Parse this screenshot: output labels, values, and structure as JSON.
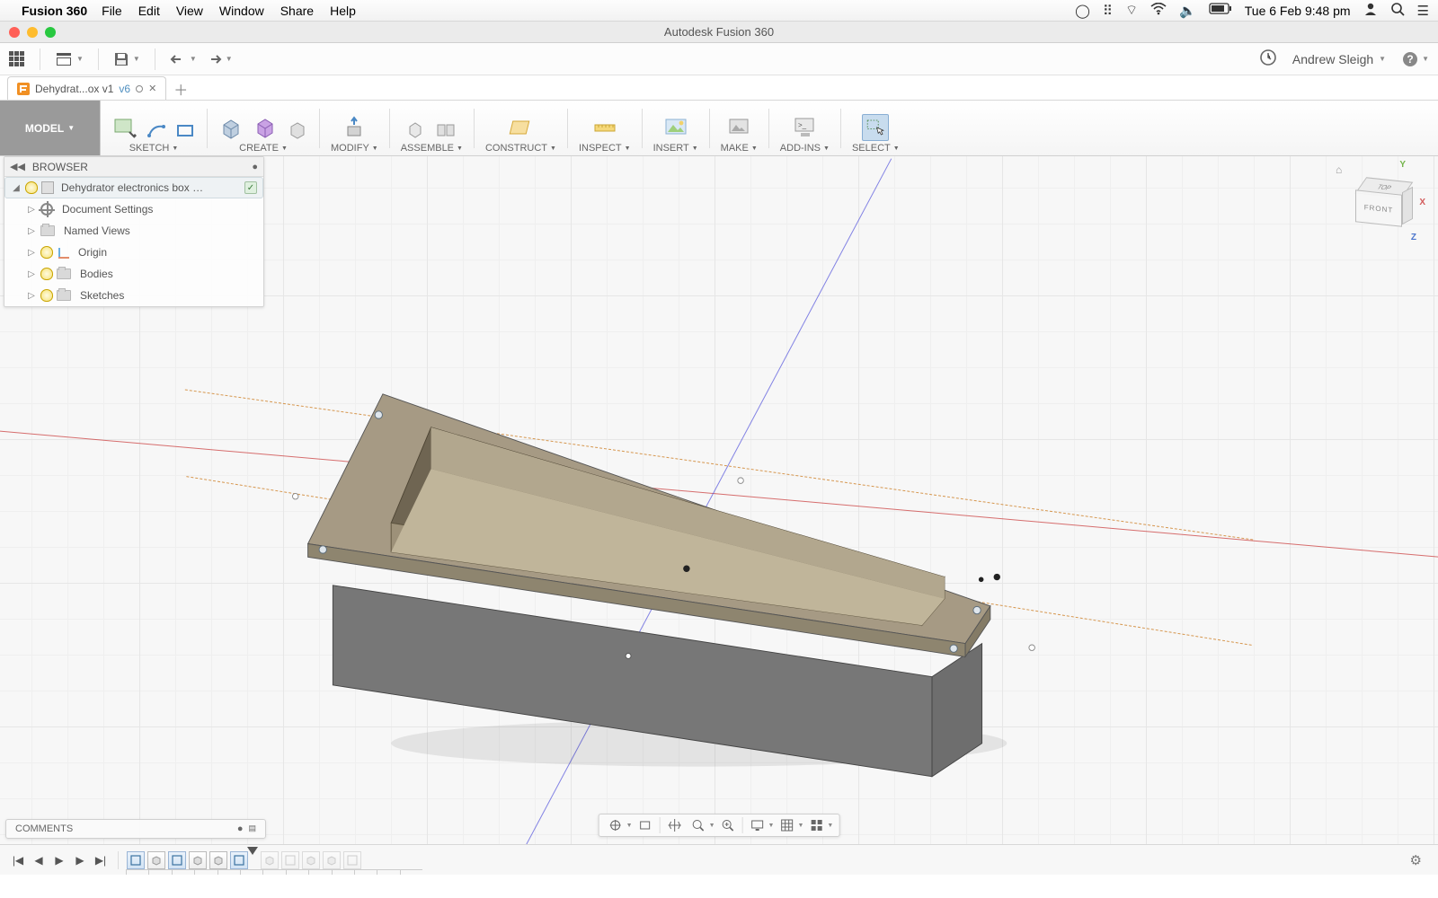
{
  "mac_menu": {
    "app": "Fusion 360",
    "items": [
      "File",
      "Edit",
      "View",
      "Window",
      "Share",
      "Help"
    ],
    "datetime": "Tue 6 Feb  9:48 pm"
  },
  "window": {
    "title": "Autodesk Fusion 360"
  },
  "qat": {
    "username": "Andrew Sleigh"
  },
  "doc_tab": {
    "name": "Dehydrat...ox v1",
    "version": "v6"
  },
  "workspace": "MODEL",
  "ribbon": {
    "groups": [
      "SKETCH",
      "CREATE",
      "MODIFY",
      "ASSEMBLE",
      "CONSTRUCT",
      "INSPECT",
      "INSERT",
      "MAKE",
      "ADD-INS",
      "SELECT"
    ]
  },
  "browser": {
    "title": "BROWSER",
    "root": "Dehydrator electronics box …",
    "items": [
      {
        "label": "Document Settings",
        "icon": "gear",
        "bulb": false,
        "expandable": true
      },
      {
        "label": "Named Views",
        "icon": "folder",
        "bulb": false,
        "expandable": true
      },
      {
        "label": "Origin",
        "icon": "origin",
        "bulb": "on",
        "expandable": true
      },
      {
        "label": "Bodies",
        "icon": "folder",
        "bulb": "on",
        "expandable": true
      },
      {
        "label": "Sketches",
        "icon": "folder",
        "bulb": "on",
        "expandable": true
      }
    ]
  },
  "viewcube": {
    "top": "TOP",
    "front": "FRONT"
  },
  "comments": {
    "label": "COMMENTS"
  },
  "timeline": {
    "features": [
      {
        "type": "sketch"
      },
      {
        "type": "extrude"
      },
      {
        "type": "sketch"
      },
      {
        "type": "extrude"
      },
      {
        "type": "extrude"
      },
      {
        "type": "sketch"
      },
      {
        "type": "extrude"
      },
      {
        "type": "dim"
      },
      {
        "type": "dim"
      },
      {
        "type": "dim"
      },
      {
        "type": "dim"
      },
      {
        "type": "dim"
      }
    ]
  }
}
